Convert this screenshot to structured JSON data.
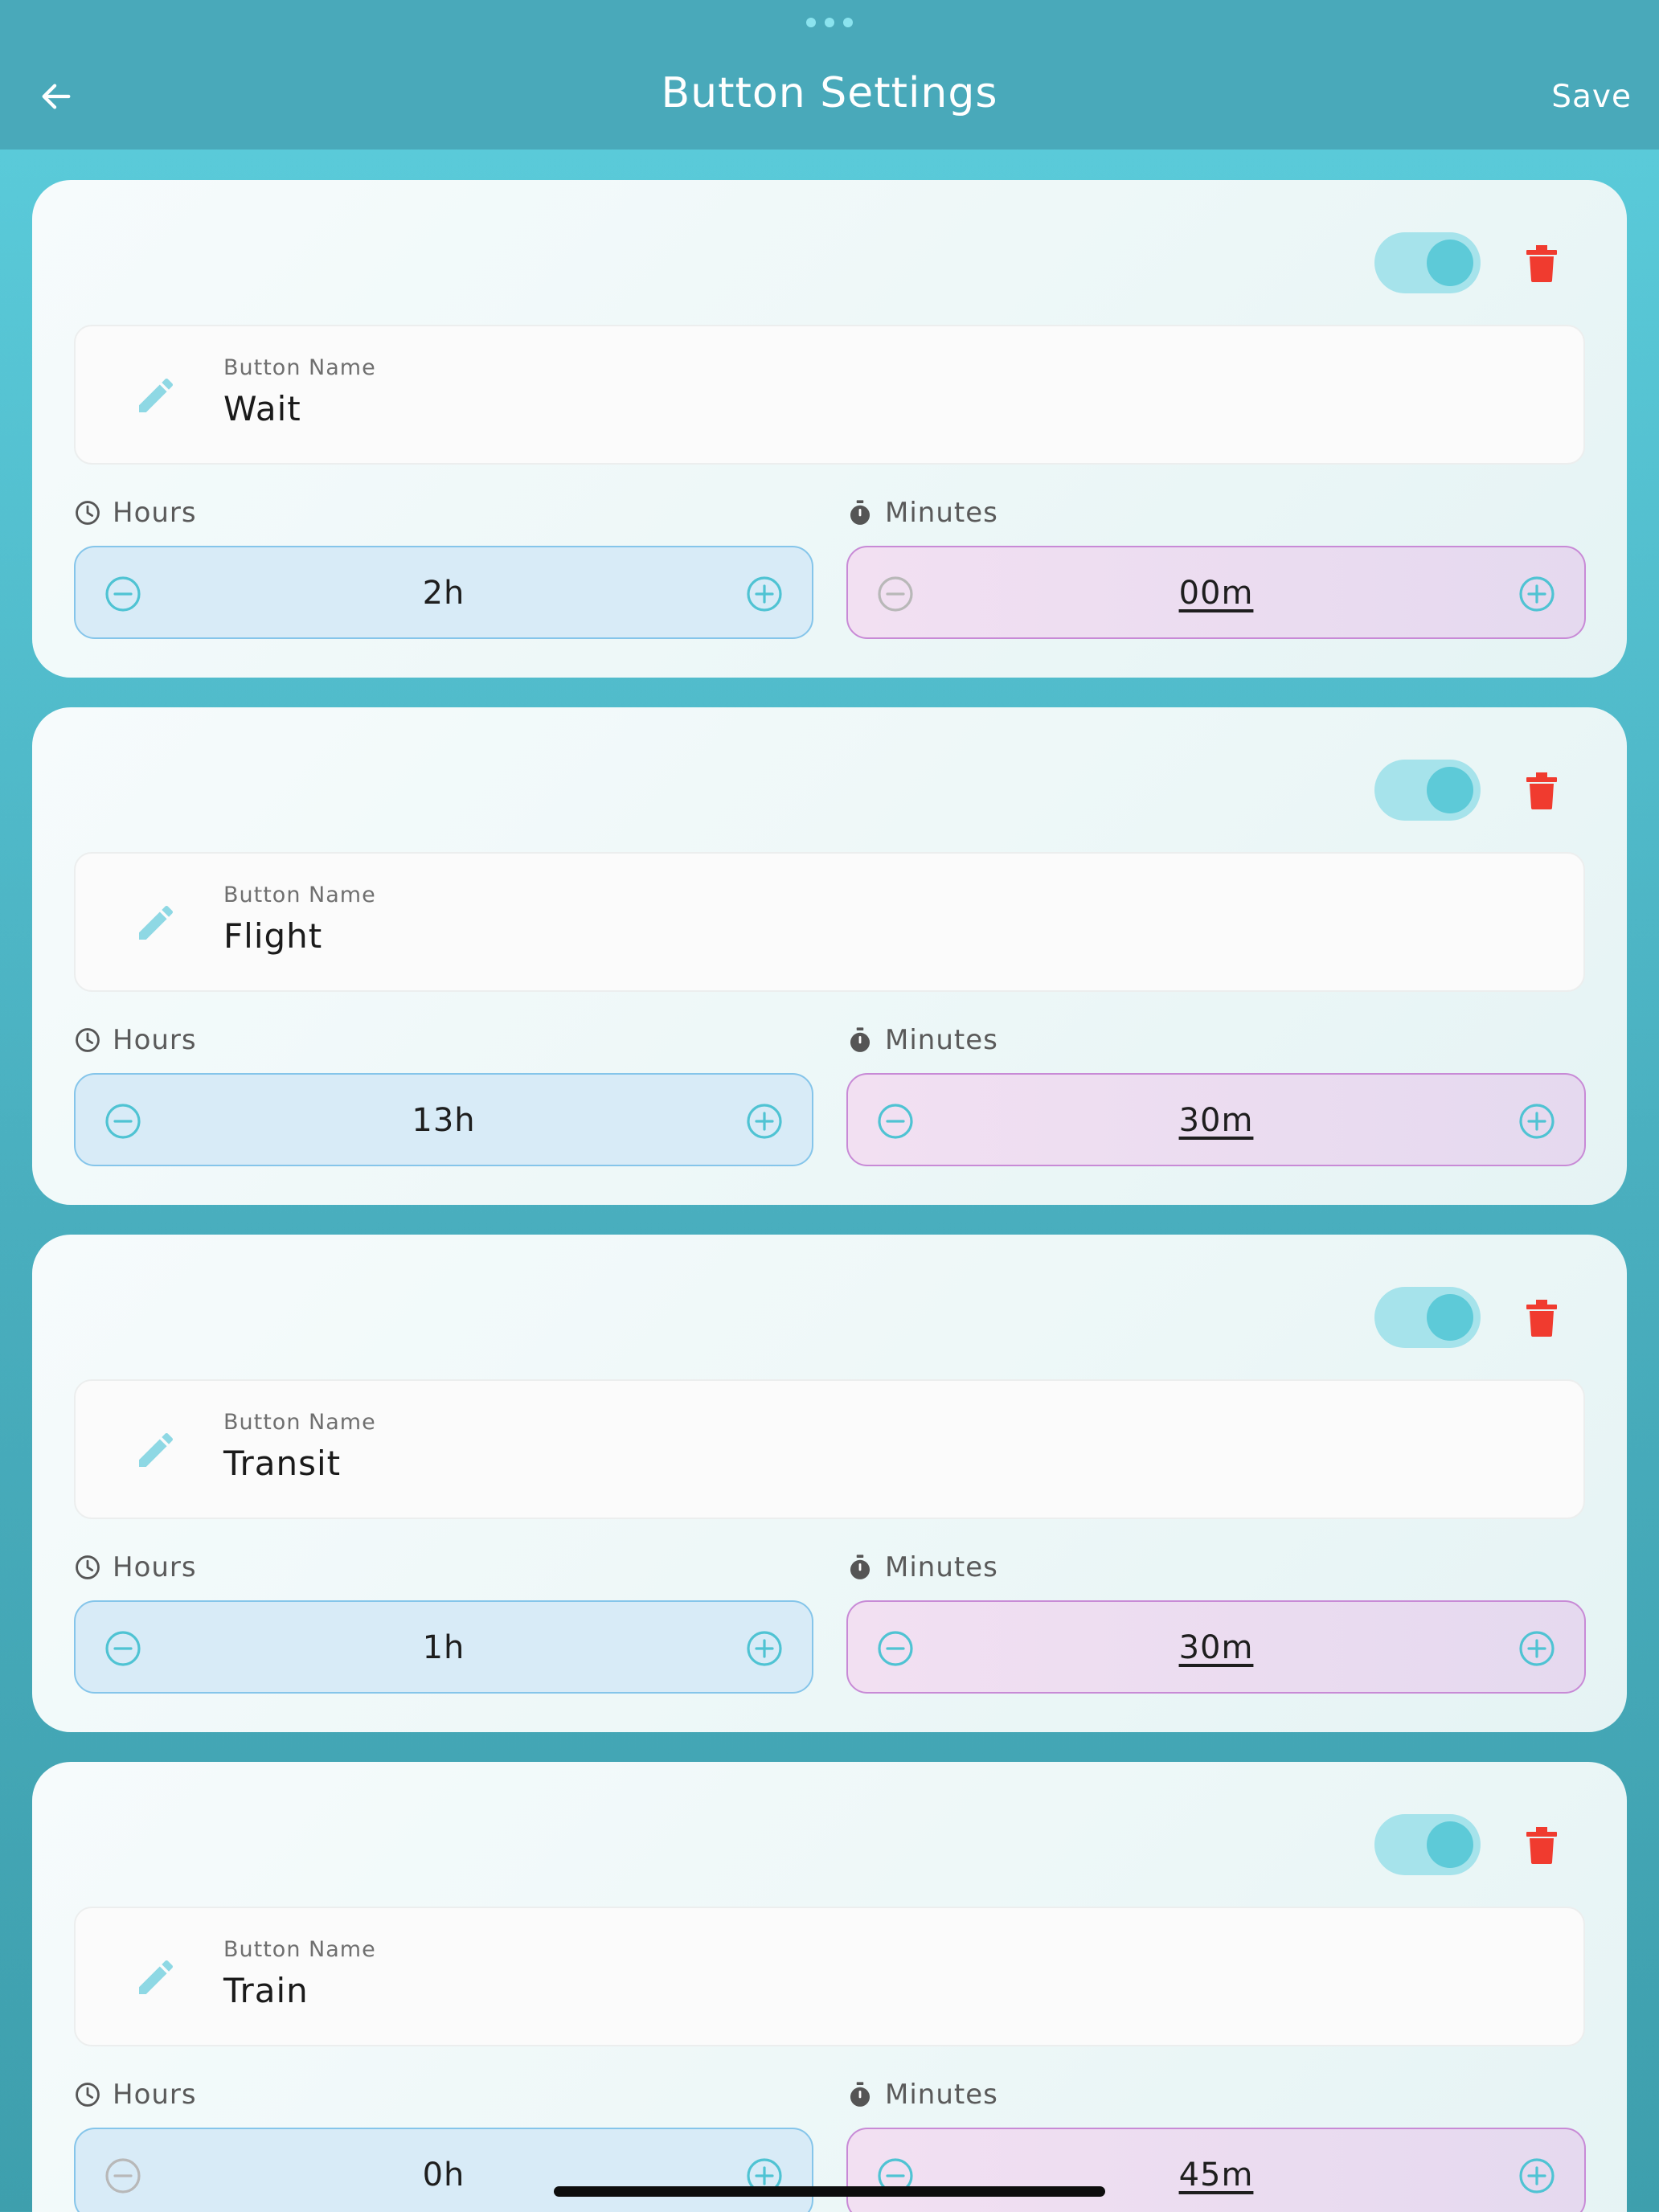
{
  "header": {
    "title": "Button Settings",
    "save_label": "Save",
    "back_icon": "arrow-left-icon",
    "more_icon": "more-dots-icon"
  },
  "colors": {
    "header_bg": "#49a9ba",
    "accent": "#5dcad8",
    "delete": "#f03b2f",
    "hours_bg": "#d8ebf7",
    "minutes_bg": "#ecdcf1"
  },
  "buttons": [
    {
      "enabled": true,
      "name_label": "Button Name",
      "name": "Wait",
      "hours_label": "Hours",
      "minutes_label": "Minutes",
      "hours": "2h",
      "minutes": "00m",
      "hours_minus_disabled": false,
      "minutes_minus_disabled": true
    },
    {
      "enabled": true,
      "name_label": "Button Name",
      "name": "Flight",
      "hours_label": "Hours",
      "minutes_label": "Minutes",
      "hours": "13h",
      "minutes": "30m",
      "hours_minus_disabled": false,
      "minutes_minus_disabled": false
    },
    {
      "enabled": true,
      "name_label": "Button Name",
      "name": "Transit",
      "hours_label": "Hours",
      "minutes_label": "Minutes",
      "hours": "1h",
      "minutes": "30m",
      "hours_minus_disabled": false,
      "minutes_minus_disabled": false
    },
    {
      "enabled": true,
      "name_label": "Button Name",
      "name": "Train",
      "hours_label": "Hours",
      "minutes_label": "Minutes",
      "hours": "0h",
      "minutes": "45m",
      "hours_minus_disabled": true,
      "minutes_minus_disabled": false
    }
  ]
}
